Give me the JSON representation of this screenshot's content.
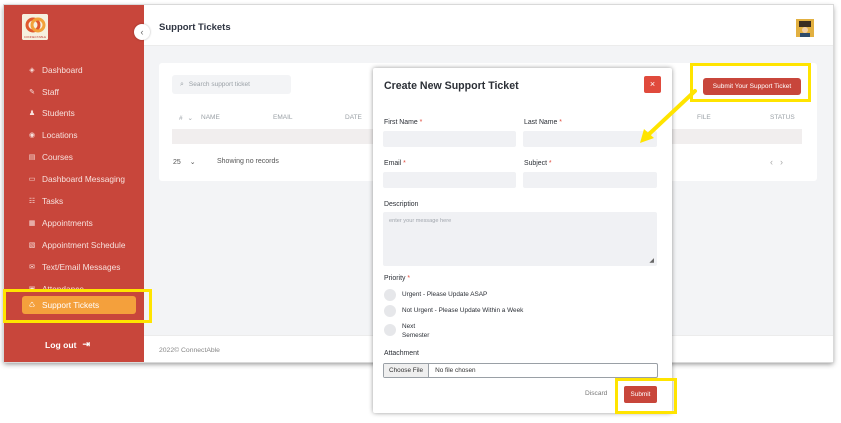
{
  "app": {
    "brand_text": "CONNECTABLE"
  },
  "sidebar": {
    "items": [
      {
        "label": "Dashboard",
        "icon": "dashboard-icon"
      },
      {
        "label": "Staff",
        "icon": "staff-icon"
      },
      {
        "label": "Students",
        "icon": "students-icon"
      },
      {
        "label": "Locations",
        "icon": "location-icon"
      },
      {
        "label": "Courses",
        "icon": "courses-icon"
      },
      {
        "label": "Dashboard Messaging",
        "icon": "message-icon"
      },
      {
        "label": "Tasks",
        "icon": "tasks-icon"
      },
      {
        "label": "Appointments",
        "icon": "calendar-icon"
      },
      {
        "label": "Appointment Schedule",
        "icon": "schedule-icon"
      },
      {
        "label": "Text/Email Messages",
        "icon": "mail-icon"
      },
      {
        "label": "Attendance",
        "icon": "attendance-icon"
      },
      {
        "label": "Support Tickets",
        "icon": "support-icon"
      }
    ],
    "active_index": 11,
    "logout_label": "Log out"
  },
  "header": {
    "title": "Support Tickets"
  },
  "table": {
    "search_placeholder": "Search support ticket",
    "columns": [
      "#",
      "NAME",
      "EMAIL",
      "DATE",
      "FILE",
      "STATUS"
    ],
    "page_size": "25",
    "records_info": "Showing no records"
  },
  "submit_ticket_button": "Submit Your Support Ticket",
  "footer": {
    "text": "2022© ConnectAble"
  },
  "modal": {
    "title": "Create New Support Ticket",
    "close_symbol": "×",
    "first_name_label": "First Name",
    "last_name_label": "Last Name",
    "email_label": "Email",
    "subject_label": "Subject",
    "required_marker": "*",
    "description_label": "Description",
    "description_placeholder": "enter your message here",
    "priority_label": "Priority",
    "priority_options": [
      {
        "label": "Urgent - Please Update ASAP"
      },
      {
        "label": "Not Urgent - Please Update Within a Week"
      },
      {
        "label_line1": "Next",
        "label_line2": "Semester"
      }
    ],
    "attachment_label": "Attachment",
    "choose_file_label": "Choose File",
    "no_file_text": "No file chosen",
    "discard_label": "Discard",
    "submit_label": "Submit"
  },
  "colors": {
    "sidebar_bg": "#c8463b",
    "active_item": "#f4a03c",
    "primary_button": "#c8463b",
    "highlight": "#ffe400"
  }
}
